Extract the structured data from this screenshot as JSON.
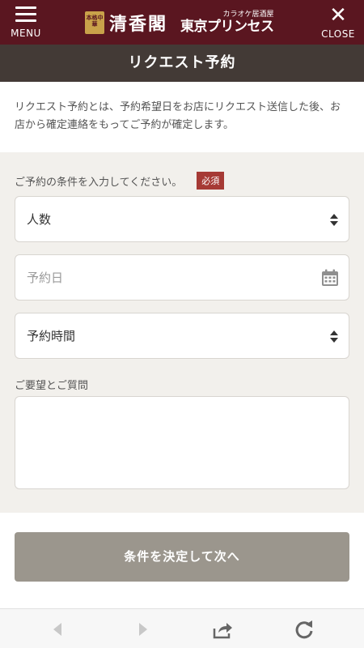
{
  "header": {
    "menu_label": "MENU",
    "close_label": "CLOSE",
    "close_glyph": "✕",
    "logo_seal": "本格中華",
    "brand_primary": "清香閣",
    "brand_secondary_sub": "カラオケ居酒屋",
    "brand_secondary_main": "東京プリンセス",
    "bg_color": "#5a1620"
  },
  "page_title": "リクエスト予約",
  "intro_text": "リクエスト予約とは、予約希望日をお店にリクエスト送信した後、お店から確定連絡をもってご予約が確定します。",
  "form": {
    "conditions_label": "ご予約の条件を入力してください。",
    "required_badge": "必須",
    "fields": {
      "people": {
        "value": "人数",
        "icon": "sort-icon"
      },
      "date": {
        "placeholder": "予約日",
        "icon": "calendar-icon"
      },
      "time": {
        "value": "予約時間",
        "icon": "sort-icon"
      }
    },
    "requests_label": "ご要望とご質問",
    "requests_value": ""
  },
  "submit_label": "条件を決定して次へ",
  "browser_bar": {
    "icons": [
      "back-icon",
      "forward-icon",
      "share-icon",
      "reload-icon"
    ]
  }
}
